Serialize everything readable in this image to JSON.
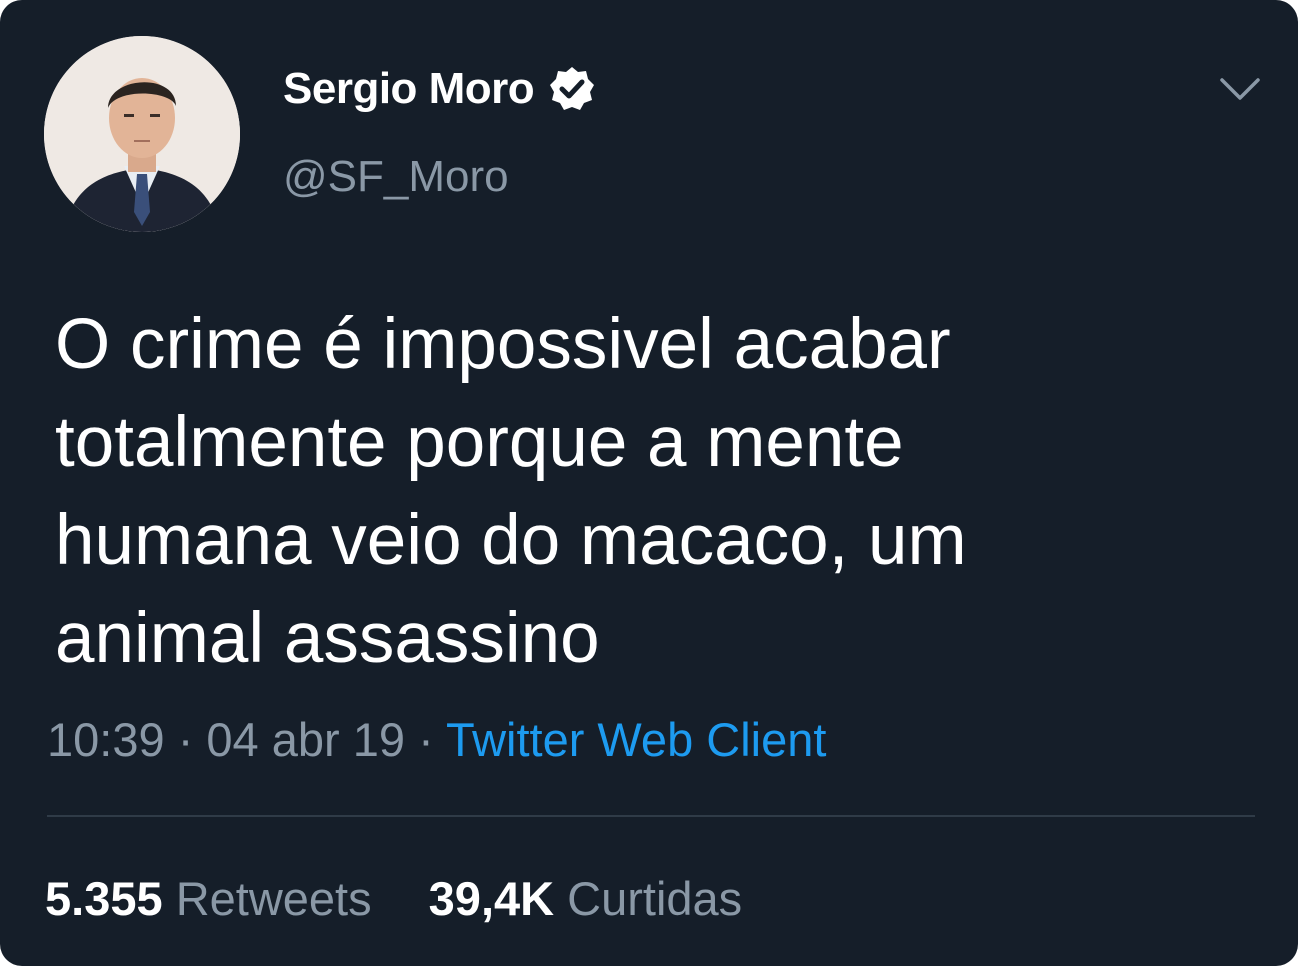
{
  "tweet": {
    "author": {
      "display_name": "Sergio Moro",
      "handle": "@SF_Moro",
      "verified": true,
      "verified_icon": "verified-badge-icon",
      "avatar_icon": "profile-photo"
    },
    "menu_icon": "chevron-down-icon",
    "text_lines": [
      "O crime é impossivel acabar",
      "totalmente porque a mente",
      "humana veio do macaco, um",
      "animal assassino"
    ],
    "time": "10:39",
    "separator": "·",
    "date": "04 abr 19",
    "source": "Twitter Web Client",
    "retweets": {
      "count": "5.355",
      "label": "Retweets"
    },
    "likes": {
      "count": "39,4K",
      "label": "Curtidas"
    }
  },
  "colors": {
    "background": "#151e29",
    "text": "#ffffff",
    "muted": "#8a98a6",
    "link": "#1d9bf0"
  }
}
